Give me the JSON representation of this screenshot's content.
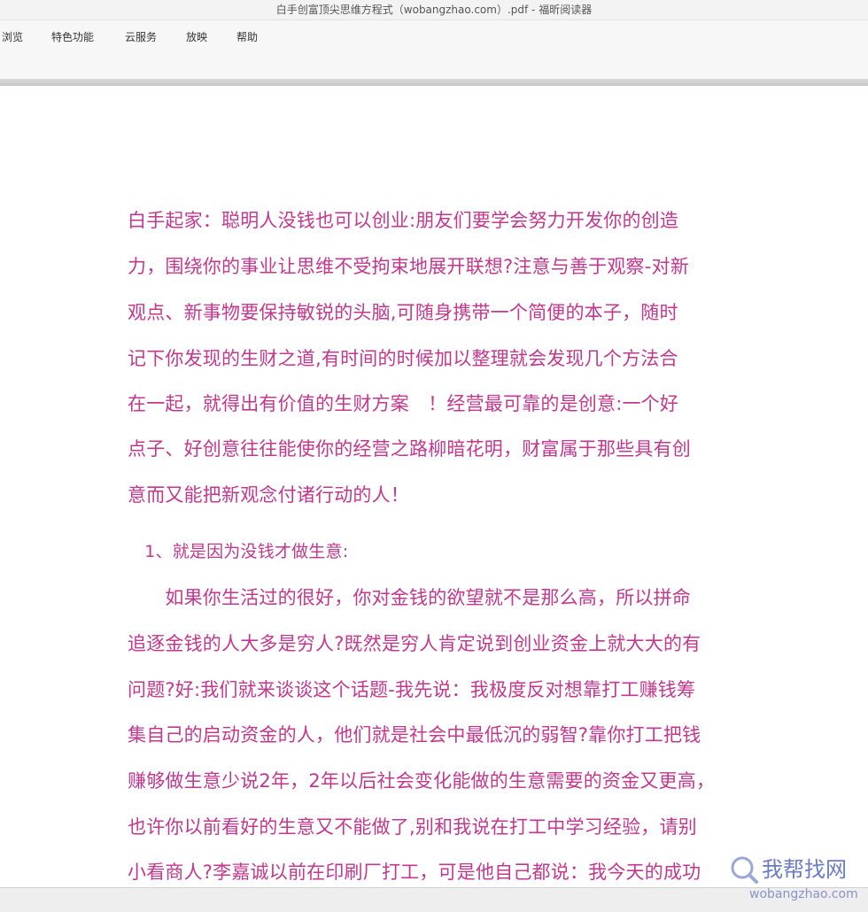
{
  "window": {
    "title": "白手创富顶尖思维方程式（wobangzhao.com）.pdf - 福昕阅读器"
  },
  "menu": {
    "items": [
      "浏览",
      "特色功能",
      "云服务",
      "放映",
      "帮助"
    ]
  },
  "document": {
    "lines": [
      "白手起家：聪明人没钱也可以创业:朋友们要学会努力开发你的创造",
      "力，围绕你的事业让思维不受拘束地展开联想?注意与善于观察-对新",
      "观点、新事物要保持敏锐的头脑,可随身携带一个简便的本子，随时",
      "记下你发现的生财之道,有时间的时候加以整理就会发现几个方法合",
      "在一起，就得出有价值的生财方案　！经营最可靠的是创意:一个好",
      "点子、好创意往往能使你的经营之路柳暗花明，财富属于那些具有创",
      "意而又能把新观念付诸行动的人！",
      "　1、就是因为没钱才做生意:",
      "　　如果你生活过的很好，你对金钱的欲望就不是那么高，所以拼命",
      "追逐金钱的人大多是穷人?既然是穷人肯定说到创业资金上就大大的有",
      "问题?好:我们就来谈谈这个话题-我先说：我极度反对想靠打工赚钱筹",
      "集自己的启动资金的人，他们就是社会中最低沉的弱智?靠你打工把钱",
      "赚够做生意少说2年，2年以后社会变化能做的生意需要的资金又更高，",
      "也许你以前看好的生意又不能做了,别和我说在打工中学习经验，请别",
      "小看商人?李嘉诚以前在印刷厂打工，可是他自己都说：我今天的成功"
    ],
    "text_color": "#c4378f"
  },
  "watermark": {
    "brand": "我帮找网",
    "url": "wobangzhao.com",
    "icon": "magnifier-icon"
  }
}
